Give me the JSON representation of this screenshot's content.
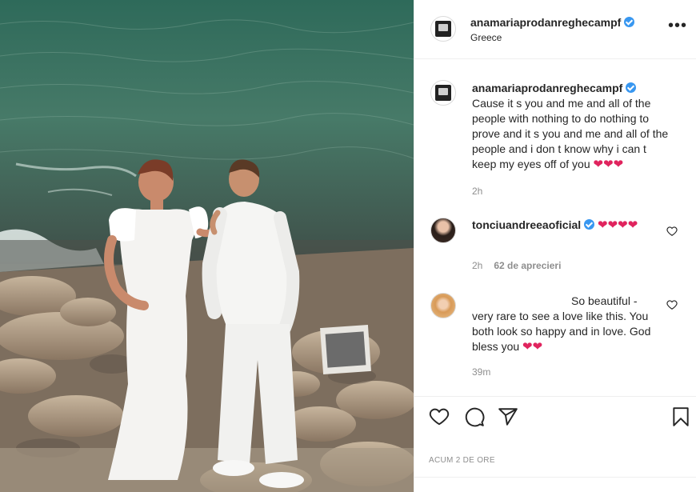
{
  "post": {
    "username": "anamariaprodanreghecampf",
    "location": "Greece",
    "more_label": "•••"
  },
  "caption": {
    "username": "anamariaprodanreghecampf",
    "text": "Cause it s you and me and all of the people with nothing to do nothing to prove and it s you and me and all of the people and i don t know why i can t keep my eyes off of you",
    "hearts": "❤❤❤",
    "time": "2h"
  },
  "comments": [
    {
      "username": "tonciuandreeaoficial",
      "text": "",
      "hearts": "❤❤❤❤",
      "time": "2h",
      "likes": "62 de aprecieri"
    },
    {
      "username": "",
      "text": "So beautiful - very rare to see a love like this. You both look so happy and in love. God bless you",
      "hearts": "❤❤",
      "time": "39m"
    }
  ],
  "footer": {
    "time_ago": "ACUM 2 DE ORE"
  },
  "colors": {
    "accent_verified": "#3897f0",
    "heart_red": "#e0245e",
    "muted_text": "#8e8e8e"
  },
  "icons": [
    "like-icon",
    "comment-icon",
    "share-icon",
    "save-icon",
    "more-icon",
    "verified-badge-icon",
    "comment-like-icon"
  ]
}
